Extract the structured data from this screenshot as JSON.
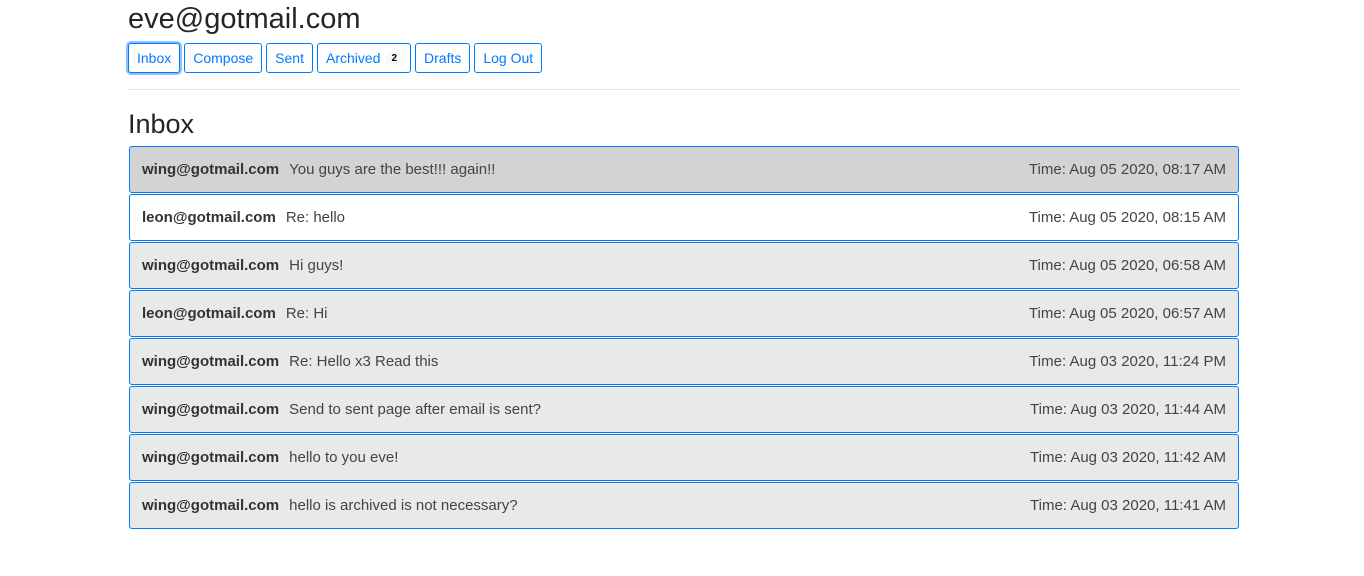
{
  "header": {
    "user_email": "eve@gotmail.com"
  },
  "nav": {
    "inbox": "Inbox",
    "compose": "Compose",
    "sent": "Sent",
    "archived": "Archived",
    "archived_badge": "2",
    "drafts": "Drafts",
    "logout": "Log Out"
  },
  "main": {
    "title": "Inbox",
    "emails": [
      {
        "sender": "wing@gotmail.com",
        "subject": "You guys are the best!!! again!!",
        "time": "Time: Aug 05 2020, 08:17 AM"
      },
      {
        "sender": "leon@gotmail.com",
        "subject": "Re: hello",
        "time": "Time: Aug 05 2020, 08:15 AM"
      },
      {
        "sender": "wing@gotmail.com",
        "subject": "Hi guys!",
        "time": "Time: Aug 05 2020, 06:58 AM"
      },
      {
        "sender": "leon@gotmail.com",
        "subject": "Re: Hi",
        "time": "Time: Aug 05 2020, 06:57 AM"
      },
      {
        "sender": "wing@gotmail.com",
        "subject": "Re: Hello x3 Read this",
        "time": "Time: Aug 03 2020, 11:24 PM"
      },
      {
        "sender": "wing@gotmail.com",
        "subject": "Send to sent page after email is sent?",
        "time": "Time: Aug 03 2020, 11:44 AM"
      },
      {
        "sender": "wing@gotmail.com",
        "subject": "hello to you eve!",
        "time": "Time: Aug 03 2020, 11:42 AM"
      },
      {
        "sender": "wing@gotmail.com",
        "subject": "hello is archived is not necessary?",
        "time": "Time: Aug 03 2020, 11:41 AM"
      }
    ]
  }
}
